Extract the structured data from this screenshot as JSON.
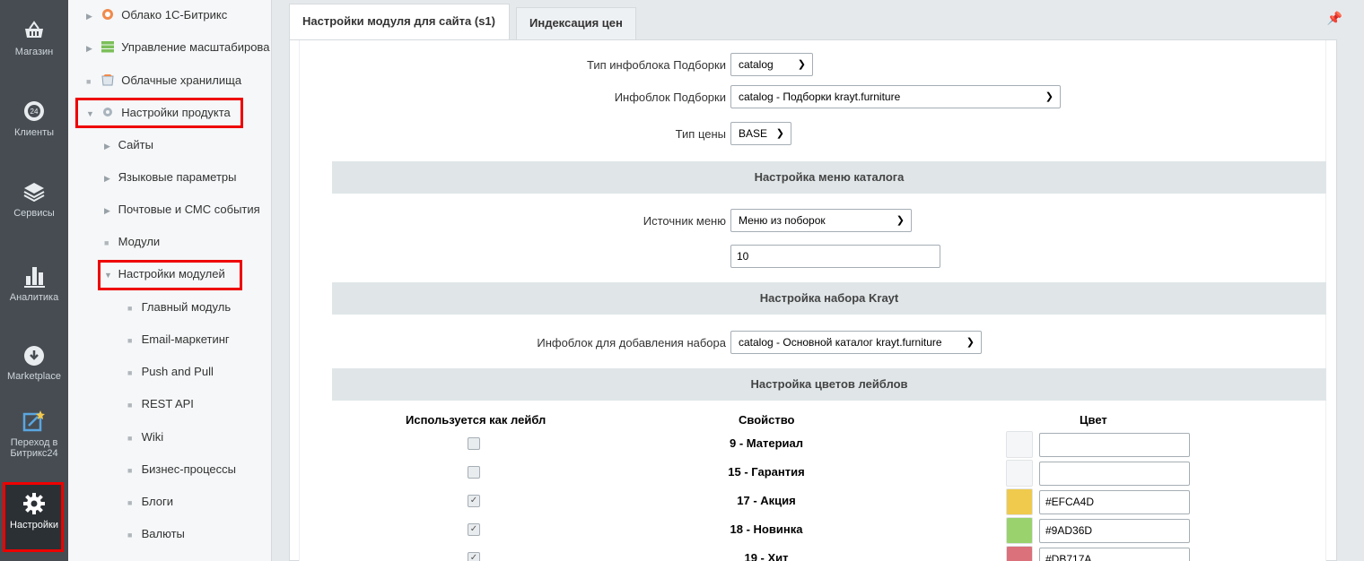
{
  "iconbar": {
    "items": [
      {
        "label": "Магазин",
        "icon": "basket-icon"
      },
      {
        "label": "Клиенты",
        "icon": "clock-24-icon"
      },
      {
        "label": "Сервисы",
        "icon": "layers-icon"
      },
      {
        "label": "Аналитика",
        "icon": "bar-chart-icon"
      },
      {
        "label": "Marketplace",
        "icon": "cloud-download-icon"
      },
      {
        "label": "Переход в Битрикс24",
        "icon": "edit-star-icon"
      },
      {
        "label": "Настройки",
        "icon": "gear-icon"
      }
    ]
  },
  "tree": {
    "items": [
      {
        "label": "Облако 1С-Битрикс"
      },
      {
        "label": "Управление масштабирова"
      },
      {
        "label": "Облачные хранилища"
      },
      {
        "label": "Настройки продукта"
      },
      {
        "label": "Сайты"
      },
      {
        "label": "Языковые параметры"
      },
      {
        "label": "Почтовые и СМС события"
      },
      {
        "label": "Модули"
      },
      {
        "label": "Настройки модулей"
      },
      {
        "label": "Главный модуль"
      },
      {
        "label": "Email-маркетинг"
      },
      {
        "label": "Push and Pull"
      },
      {
        "label": "REST API"
      },
      {
        "label": "Wiki"
      },
      {
        "label": "Бизнес-процессы"
      },
      {
        "label": "Блоги"
      },
      {
        "label": "Валюты"
      }
    ]
  },
  "tabs": [
    {
      "label": "Настройки модуля для сайта (s1)"
    },
    {
      "label": "Индексация цен"
    }
  ],
  "form": {
    "collection_type_label": "Тип инфоблока Подборки",
    "collection_type_value": "catalog",
    "collection_iblock_label": "Инфоблок Подборки",
    "collection_iblock_value": "catalog - Подборки krayt.furniture",
    "price_type_label": "Тип цены",
    "price_type_value": "BASE",
    "section_menu": "Настройка меню каталога",
    "menu_source_label": "Источник меню",
    "menu_source_value": "Меню из поборок",
    "menu_count_value": "10",
    "section_set": "Настройка набора Krayt",
    "set_iblock_label": "Инфоблок для добавления набора",
    "set_iblock_value": "catalog - Основной каталог krayt.furniture",
    "section_labels": "Настройка цветов лейблов",
    "col_used": "Используется как лейбл",
    "col_prop": "Свойство",
    "col_color": "Цвет"
  },
  "labels": [
    {
      "checked": false,
      "prop": "9 - Материал",
      "color": "",
      "swatch": "#f5f6f7"
    },
    {
      "checked": false,
      "prop": "15 - Гарантия",
      "color": "",
      "swatch": "#f5f6f7"
    },
    {
      "checked": true,
      "prop": "17 - Акция",
      "color": "#EFCA4D",
      "swatch": "#EFCA4D"
    },
    {
      "checked": true,
      "prop": "18 - Новинка",
      "color": "#9AD36D",
      "swatch": "#9AD36D"
    },
    {
      "checked": true,
      "prop": "19 - Хит",
      "color": "#DB717A",
      "swatch": "#DB717A"
    }
  ]
}
